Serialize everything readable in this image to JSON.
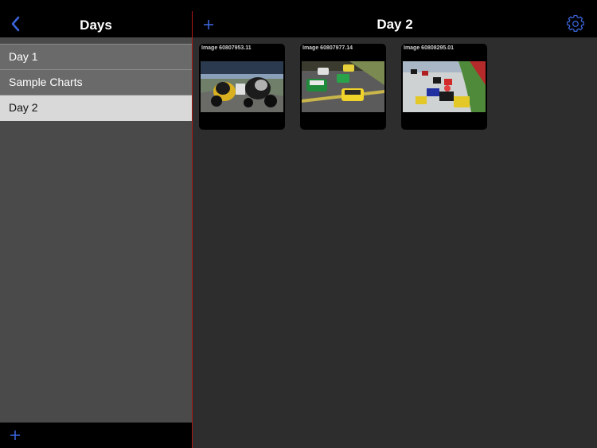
{
  "sidebar": {
    "title": "Days",
    "items": [
      {
        "label": "Day 1"
      },
      {
        "label": "Sample Charts"
      },
      {
        "label": "Day 2"
      }
    ],
    "selected_index": 2
  },
  "main": {
    "title": "Day 2",
    "images": [
      {
        "label": "Image 60807953.11",
        "subject": "motorcycle racing"
      },
      {
        "label": "Image 60807977.14",
        "subject": "stock car racing"
      },
      {
        "label": "Image 60808295.01",
        "subject": "kart racing"
      }
    ]
  },
  "icons": {
    "back": "chevron-left-icon",
    "add": "plus-icon",
    "settings": "gear-icon"
  },
  "colors": {
    "accent": "#3a64d8",
    "divider": "#b01818",
    "selected_row": "#d9d9d9"
  }
}
